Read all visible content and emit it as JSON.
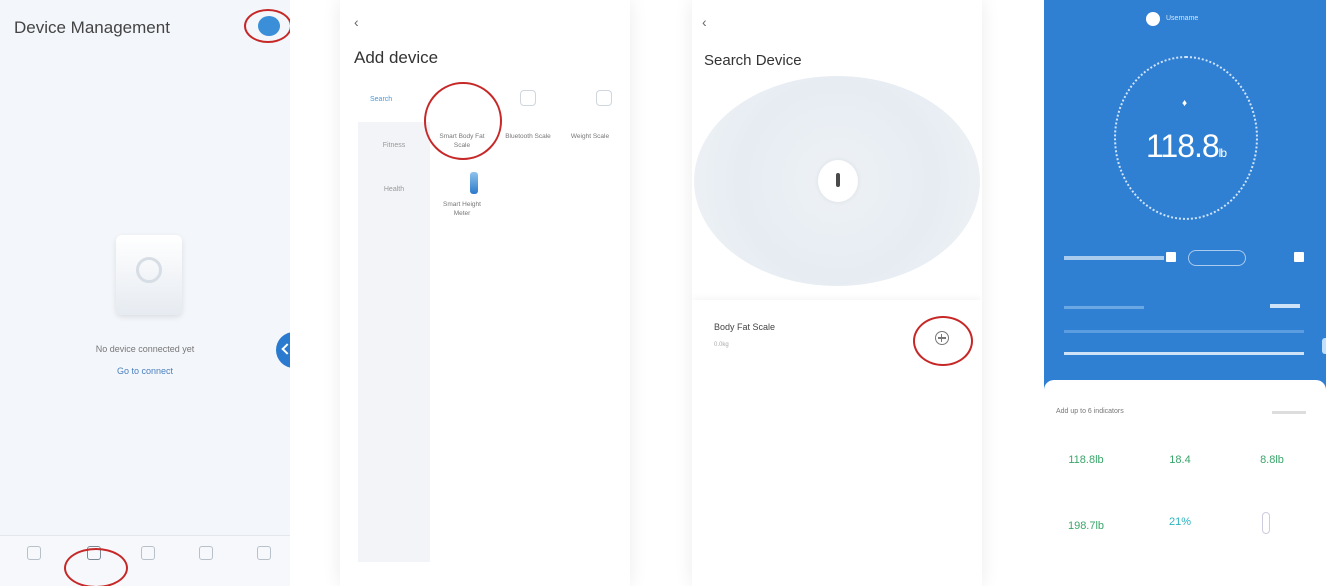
{
  "screen1": {
    "title": "Device Management",
    "empty_text": "No device connected yet",
    "empty_link": "Go to connect",
    "tabs": [
      "",
      "",
      "",
      "",
      ""
    ]
  },
  "screen2": {
    "back": "‹",
    "title": "Add device",
    "search_tab": "Search",
    "categories": [
      "Fitness",
      "Health"
    ],
    "devices": [
      {
        "label": "Smart Body Fat Scale"
      },
      {
        "label": "Bluetooth Scale"
      },
      {
        "label": "Weight Scale"
      },
      {
        "label": "Smart Height Meter"
      }
    ]
  },
  "screen3": {
    "back": "‹",
    "title": "Search Device",
    "device_name": "Body Fat Scale",
    "device_sub": "0.0kg"
  },
  "screen4": {
    "user": "Username",
    "weight": "118.8",
    "weight_unit": "lb",
    "panel_title": "Add up to 6 indicators",
    "metrics": [
      {
        "value": "118.8lb",
        "color": "#3aa66a"
      },
      {
        "value": "18.4",
        "color": "#3aa66a"
      },
      {
        "value": "8.8lb",
        "color": "#3aa66a"
      },
      {
        "value": "198.7lb",
        "color": "#3aa66a"
      },
      {
        "value": "21%",
        "color": "#2bb3c0"
      }
    ]
  },
  "colors": {
    "annotation": "#c62828",
    "primary_blue": "#2f7fd3"
  }
}
